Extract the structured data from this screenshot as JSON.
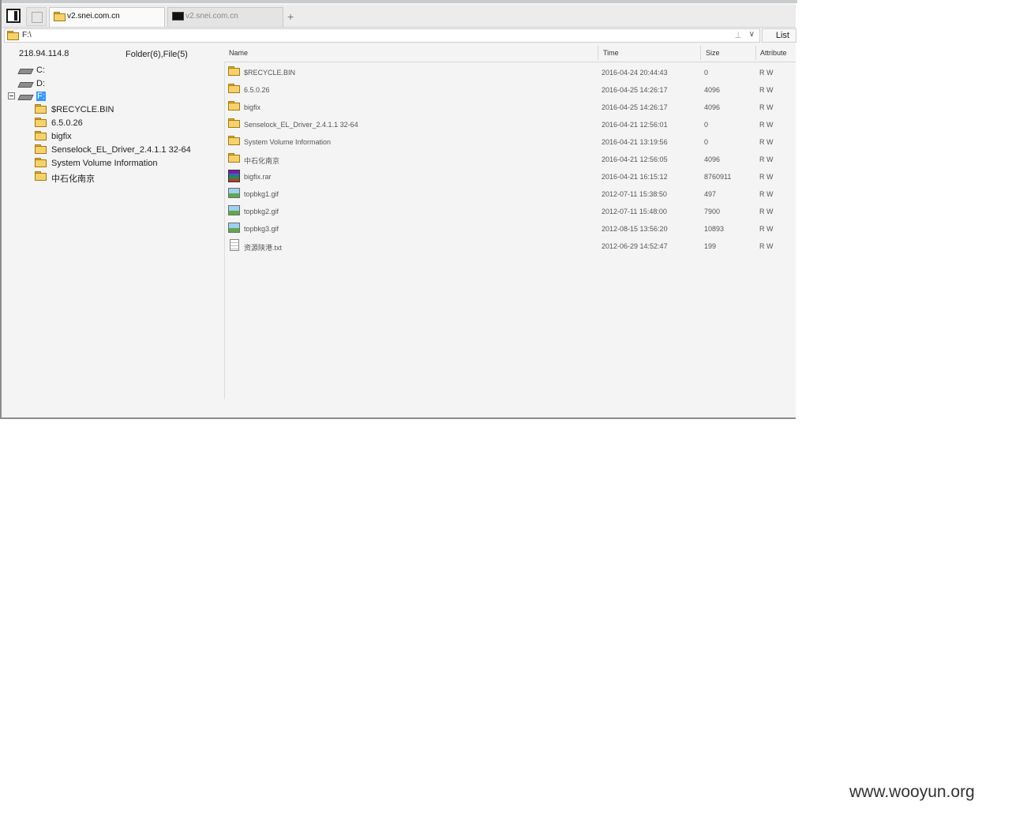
{
  "tabs": [
    {
      "label": "v2.snei.com.cn",
      "icon": "folder-icon",
      "active": true
    },
    {
      "label": "v2.snei.com.cn",
      "icon": "terminal-icon",
      "active": false
    }
  ],
  "new_tab_label": "+",
  "address": {
    "path": "F:\\",
    "pin_glyph": "⊥",
    "dropdown_glyph": "∨"
  },
  "view_mode": "List",
  "info": {
    "ip": "218.94.114.8",
    "counts": "Folder(6),File(5)"
  },
  "columns": {
    "name": "Name",
    "time": "Time",
    "size": "Size",
    "attribute": "Attribute"
  },
  "tree": {
    "drives": [
      {
        "label": "C:"
      },
      {
        "label": "D:"
      },
      {
        "label": "F:",
        "selected": true,
        "expanded_glyph": "-"
      }
    ],
    "folders": [
      {
        "label": "$RECYCLE.BIN"
      },
      {
        "label": "6.5.0.26"
      },
      {
        "label": "bigfix"
      },
      {
        "label": "Senselock_EL_Driver_2.4.1.1 32-64"
      },
      {
        "label": "System Volume Information"
      },
      {
        "label": "中石化南京"
      }
    ]
  },
  "files": [
    {
      "name": "$RECYCLE.BIN",
      "time": "2016-04-24 20:44:43",
      "size": "0",
      "attr": "R W",
      "icon": "folder-icon"
    },
    {
      "name": "6.5.0.26",
      "time": "2016-04-25 14:26:17",
      "size": "4096",
      "attr": "R W",
      "icon": "folder-icon"
    },
    {
      "name": "bigfix",
      "time": "2016-04-25 14:26:17",
      "size": "4096",
      "attr": "R W",
      "icon": "folder-icon"
    },
    {
      "name": "Senselock_EL_Driver_2.4.1.1 32-64",
      "time": "2016-04-21 12:56:01",
      "size": "0",
      "attr": "R W",
      "icon": "folder-icon"
    },
    {
      "name": "System Volume Information",
      "time": "2016-04-21 13:19:56",
      "size": "0",
      "attr": "R W",
      "icon": "folder-icon"
    },
    {
      "name": "中石化南京",
      "time": "2016-04-21 12:56:05",
      "size": "4096",
      "attr": "R W",
      "icon": "folder-icon"
    },
    {
      "name": "bigfix.rar",
      "time": "2016-04-21 16:15:12",
      "size": "8760911",
      "attr": "R W",
      "icon": "rar-archive-icon"
    },
    {
      "name": "topbkg1.gif",
      "time": "2012-07-11 15:38:50",
      "size": "497",
      "attr": "R W",
      "icon": "image-icon"
    },
    {
      "name": "topbkg2.gif",
      "time": "2012-07-11 15:48:00",
      "size": "7900",
      "attr": "R W",
      "icon": "image-icon"
    },
    {
      "name": "topbkg3.gif",
      "time": "2012-08-15 13:56:20",
      "size": "10893",
      "attr": "R W",
      "icon": "image-icon"
    },
    {
      "name": "资源陕港.txt",
      "time": "2012-06-29 14:52:47",
      "size": "199",
      "attr": "R W",
      "icon": "text-file-icon"
    }
  ],
  "watermark": "www.wooyun.org",
  "colors": {
    "selection": "#3399ff",
    "folder": "#f7d169",
    "chrome_bg": "#f4f4f4"
  }
}
